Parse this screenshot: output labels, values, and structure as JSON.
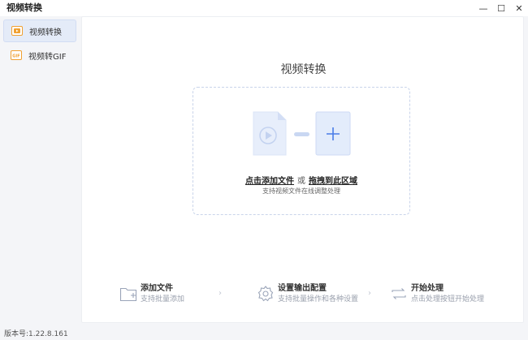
{
  "app": {
    "title": "视频转换"
  },
  "window": {
    "minimize": "—",
    "maximize": "☐",
    "close": "✕"
  },
  "sidebar": {
    "items": [
      {
        "label": "视频转换",
        "icon": "video-convert-icon",
        "active": true
      },
      {
        "label": "视频转GIF",
        "icon": "gif-icon",
        "active": false
      }
    ]
  },
  "main": {
    "title": "视频转换",
    "dropzone": {
      "click_add": "点击添加文件",
      "or": "或",
      "drag_here": "拖拽到此区域",
      "hint": "支持视频文件在线调整处理"
    },
    "steps": [
      {
        "title": "添加文件",
        "subtitle": "支持批量添加",
        "icon": "add-folder-icon"
      },
      {
        "title": "设置输出配置",
        "subtitle": "支持批量操作和各种设置",
        "icon": "settings-gear-icon"
      },
      {
        "title": "开始处理",
        "subtitle": "点击处理按钮开始处理",
        "icon": "refresh-cycle-icon"
      }
    ],
    "arrow": "›"
  },
  "footer": {
    "version": "版本号:1.22.8.161"
  },
  "colors": {
    "accent": "#4a7de8",
    "accent_light": "#e3ecfb",
    "orange": "#f0a030"
  }
}
